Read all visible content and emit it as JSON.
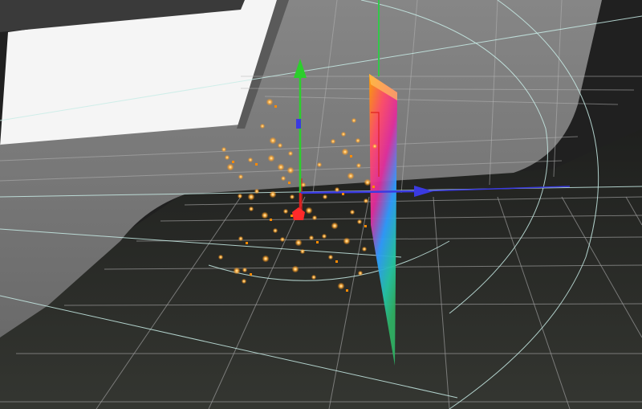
{
  "viewport": {
    "background": "#232323",
    "wall_color": "#7b7b7b",
    "floor_color": "#2b2d2a",
    "grid_color": "#d7d7d7",
    "guide_color": "#bfe9e3",
    "window_color": "#f4f4f4"
  },
  "gizmo": {
    "x_axis_color": "#3a3ae0",
    "y_axis_color": "#2ccf2c",
    "z_axis_color": "#e02020",
    "origin_color": "#ff2a2a"
  },
  "particles": {
    "color": "#ffb54a",
    "glow_color": "#ff8a00",
    "count_visible": 60
  },
  "spectrum_plane": {
    "colors": [
      "#ff9a00",
      "#ff3d7a",
      "#e02ca0",
      "#3aa0ff",
      "#26c6a6",
      "#34b060"
    ]
  }
}
